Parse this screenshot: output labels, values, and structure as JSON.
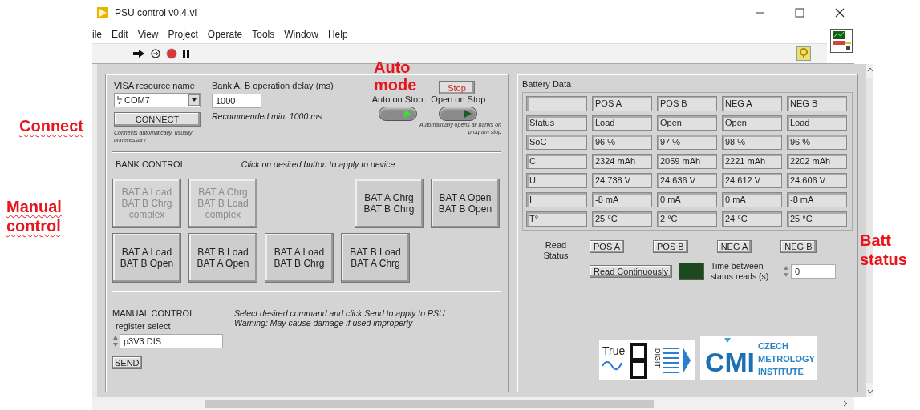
{
  "window": {
    "title": "PSU control v0.4.vi"
  },
  "menu": [
    "ile",
    "Edit",
    "View",
    "Project",
    "Operate",
    "Tools",
    "Window",
    "Help"
  ],
  "connection": {
    "visa_label": "VISA resource name",
    "visa_value": "COM7",
    "delay_label": "Bank A, B operation delay (ms)",
    "delay_value": "1000",
    "delay_note": "Recommended min. 1000 ms",
    "connect_button": "CONNECT",
    "connect_note": "Connects automatically, usually unnecessary"
  },
  "auto_mode": {
    "stop_button": "Stop",
    "switches": [
      {
        "label": "Auto on Stop",
        "lit": true
      },
      {
        "label": "Open on Stop",
        "lit": false
      }
    ],
    "note": "Automatically opens all banks on program stop"
  },
  "bank_control": {
    "title": "BANK CONTROL",
    "hint": "Click on desired button to apply to device",
    "rows": [
      {
        "left": [
          {
            "lines": [
              "BAT A Load",
              "BAT B Chrg",
              "complex"
            ],
            "disabled": true
          },
          {
            "lines": [
              "BAT A Chrg",
              "BAT B Load",
              "complex"
            ],
            "disabled": true
          }
        ],
        "right": [
          {
            "lines": [
              "BAT A Chrg",
              "BAT B Chrg"
            ],
            "disabled": false
          },
          {
            "lines": [
              "BAT A Open",
              "BAT B Open"
            ],
            "disabled": false
          }
        ]
      },
      {
        "left": [
          {
            "lines": [
              "BAT A Load",
              "BAT B Open"
            ],
            "disabled": false
          },
          {
            "lines": [
              "BAT B Load",
              "BAT A Open"
            ],
            "disabled": false
          },
          {
            "lines": [
              "BAT A Load",
              "BAT B Chrg"
            ],
            "disabled": false
          },
          {
            "lines": [
              "BAT B Load",
              "BAT A Chrg"
            ],
            "disabled": false
          }
        ],
        "right": []
      }
    ]
  },
  "manual_control": {
    "title": "MANUAL CONTROL",
    "hints": [
      "Select desired command and click Send to apply to PSU",
      "Warning: May cause damage if used improperly"
    ],
    "register_label": "register select",
    "register_value": "p3V3 DIS",
    "send_button": "SEND"
  },
  "battery_data": {
    "title": "Battery Data",
    "columns": [
      "POS A",
      "POS B",
      "NEG A",
      "NEG B"
    ],
    "rows": [
      {
        "label": "Status",
        "values": [
          "Load",
          "Open",
          "Open",
          "Load"
        ]
      },
      {
        "label": "SoC",
        "values": [
          "96 %",
          "97 %",
          "98 %",
          "96 %"
        ]
      },
      {
        "label": "C",
        "values": [
          "2324 mAh",
          "2059 mAh",
          "2221 mAh",
          "2202 mAh"
        ]
      },
      {
        "label": "U",
        "values": [
          "24.738 V",
          "24.636 V",
          "24.612 V",
          "24.606 V"
        ]
      },
      {
        "label": "I",
        "values": [
          "-8 mA",
          "0 mA",
          "0 mA",
          "-8 mA"
        ]
      },
      {
        "label": "T°",
        "values": [
          "25 °C",
          "2 °C",
          "24 °C",
          "25 °C"
        ]
      }
    ]
  },
  "read_status": {
    "label": "Read Status",
    "buttons": [
      "POS A",
      "POS B",
      "NEG A",
      "NEG B"
    ],
    "continuous_button": "Read Continuously",
    "led_on": false,
    "interval_label": "Time between status reads (s)",
    "interval_value": "0"
  },
  "logos": {
    "truedigit": {
      "word": "True",
      "digit": "DIGIT"
    },
    "cmi": {
      "mark": "CMI",
      "lines": [
        "CZECH",
        "METROLOGY",
        "INSTITUTE"
      ]
    }
  },
  "annotations": [
    {
      "text": "Connect",
      "underlined": true
    },
    {
      "text": "Manual control",
      "underlined": true
    },
    {
      "text": "Auto mode",
      "underlined": false
    },
    {
      "text": "Batt status",
      "underlined": false
    }
  ]
}
